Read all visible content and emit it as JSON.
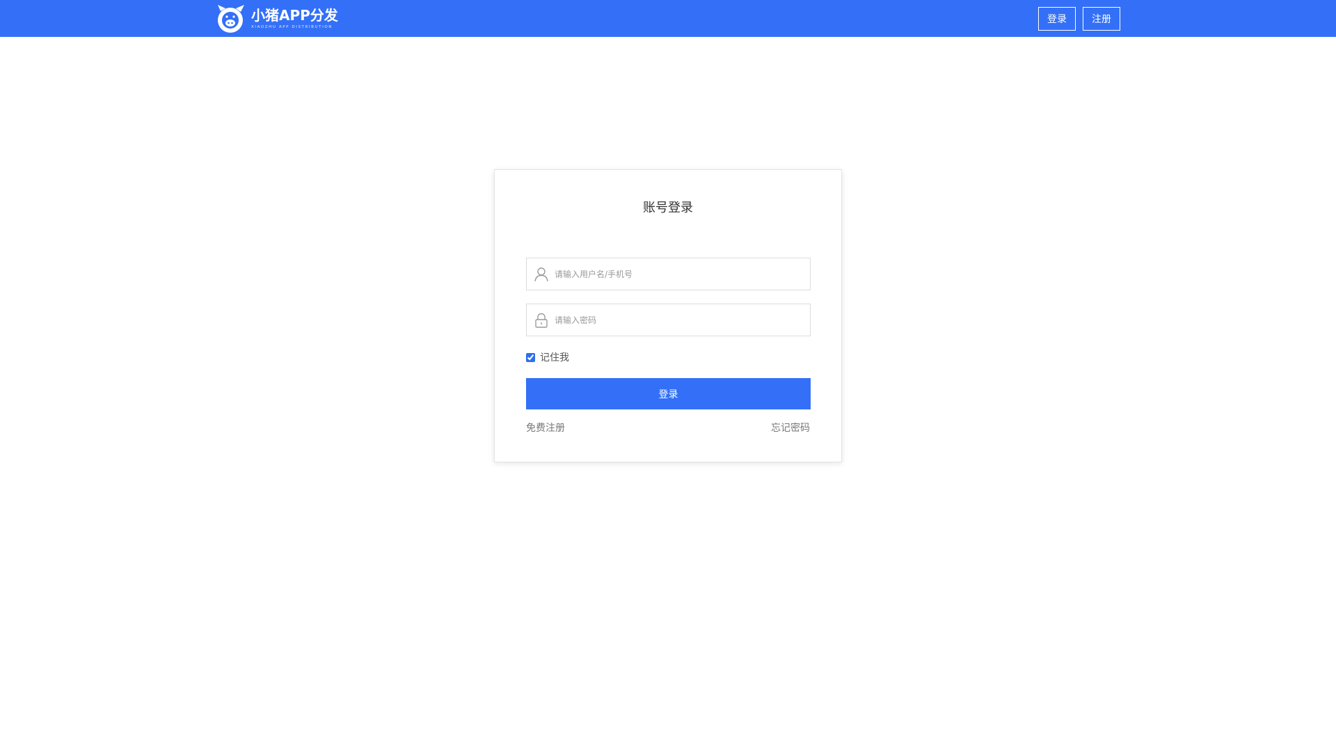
{
  "header": {
    "logo_title": "小猪APP分发",
    "logo_subtitle": "XIAOZHU APP DISTRIBUTION",
    "nav_login": "登录",
    "nav_register": "注册"
  },
  "login_card": {
    "title": "账号登录",
    "username_placeholder": "请输入用户名/手机号",
    "password_placeholder": "请输入密码",
    "remember_label": "记住我",
    "remember_checked": true,
    "submit_label": "登录",
    "register_link": "免费注册",
    "forgot_link": "忘记密码"
  },
  "icons": {
    "username": "user-icon",
    "password": "lock-icon",
    "logo": "pig-logo-icon"
  },
  "colors": {
    "brand_blue": "#3370f7",
    "background": "#ffffff",
    "border": "#dcdcdc",
    "link_gray": "#777777"
  }
}
